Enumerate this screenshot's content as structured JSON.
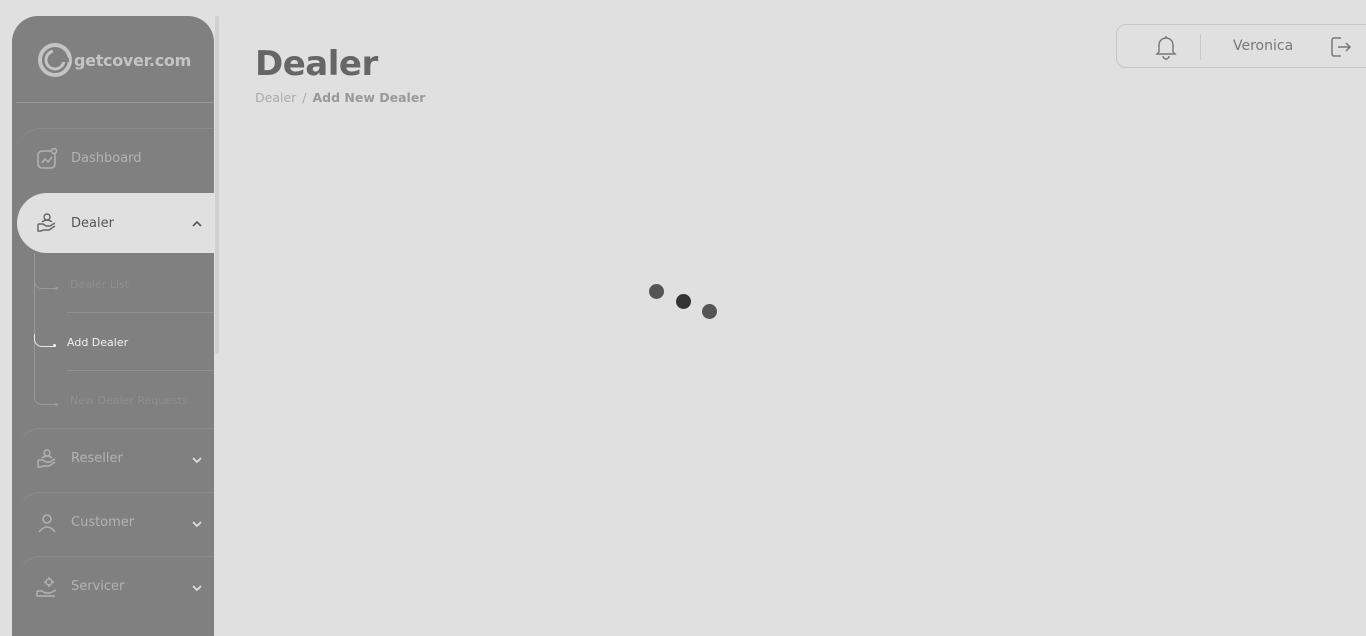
{
  "brand": {
    "logo_text": "getcover.com"
  },
  "sidebar": {
    "items": [
      {
        "label": "Dashboard",
        "icon": "chart-trend-icon"
      },
      {
        "label": "Dealer",
        "icon": "dealer-handshake-icon",
        "expanded": true
      },
      {
        "label": "Reseller",
        "icon": "reseller-handshake-icon"
      },
      {
        "label": "Customer",
        "icon": "user-icon"
      },
      {
        "label": "Servicer",
        "icon": "servicer-hand-gear-icon"
      }
    ],
    "dealer_subitems": [
      {
        "label": "Dealer List"
      },
      {
        "label": "Add Dealer",
        "active": true
      },
      {
        "label": "New Dealer Requests"
      }
    ]
  },
  "page": {
    "title": "Dealer",
    "breadcrumb": {
      "parent": "Dealer",
      "separator": "/",
      "current": "Add New Dealer"
    }
  },
  "topbar": {
    "user_name": "Veronica",
    "icons": [
      "bell-icon",
      "logout-icon"
    ]
  },
  "loader": {
    "state": "loading",
    "colors": [
      "#555555",
      "#333333",
      "#555555"
    ]
  }
}
